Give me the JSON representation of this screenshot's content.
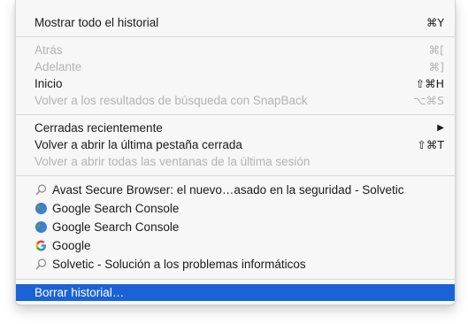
{
  "menu": {
    "show_all": {
      "label": "Mostrar todo el historial",
      "shortcut": "⌘Y"
    },
    "nav": [
      {
        "label": "Atrás",
        "shortcut": "⌘[",
        "enabled": false
      },
      {
        "label": "Adelante",
        "shortcut": "⌘]",
        "enabled": false
      },
      {
        "label": "Inicio",
        "shortcut": "⇧⌘H",
        "enabled": true
      },
      {
        "label": "Volver a los resultados de búsqueda con SnapBack",
        "shortcut": "⌥⌘S",
        "enabled": false
      }
    ],
    "recent": [
      {
        "label": "Cerradas recientemente",
        "shortcut": "▶",
        "enabled": true
      },
      {
        "label": "Volver a abrir la última pestaña cerrada",
        "shortcut": "⇧⌘T",
        "enabled": true
      },
      {
        "label": "Volver a abrir todas las ventanas de la última sesión",
        "shortcut": "",
        "enabled": false
      }
    ],
    "history": [
      {
        "label": "Avast Secure Browser: el nuevo…asado en la seguridad - Solvetic",
        "icon": "search-icon"
      },
      {
        "label": "Google Search Console",
        "icon": "globe-icon"
      },
      {
        "label": "Google Search Console",
        "icon": "globe-icon"
      },
      {
        "label": "Google",
        "icon": "google-g-icon"
      },
      {
        "label": "Solvetic - Solución a los problemas informáticos",
        "icon": "search-icon"
      }
    ],
    "clear": {
      "label": "Borrar historial…"
    },
    "colors": {
      "selection": "#1a62d6",
      "disabled_text": "#b3b3b3",
      "menu_bg": "#f7f7f7"
    }
  }
}
